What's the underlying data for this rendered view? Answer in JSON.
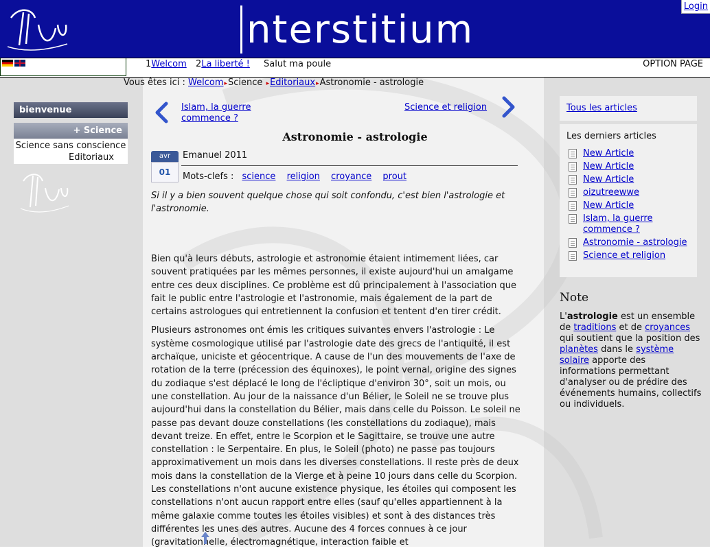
{
  "header": {
    "title": "nterstitium",
    "login": "Login"
  },
  "nav": {
    "items": [
      {
        "num": "1",
        "label": "Welcom"
      },
      {
        "num": "2",
        "label": "La liberté !"
      }
    ],
    "greeting": "Salut ma poule",
    "option": "OPTION PAGE"
  },
  "breadcrumb": {
    "prefix": "Vous êtes ici :",
    "home": "Welcom",
    "section": "Science",
    "sub": "Editoriaux",
    "current": "Astronomie - astrologie"
  },
  "sidebar": {
    "menu1": "bienvenue",
    "menu2": "+ Science",
    "sub1": "Science sans conscience",
    "sub2": "Editoriaux"
  },
  "article": {
    "prev": "Islam, la guerre commence ?",
    "next": "Science et religion",
    "title": "Astronomie - astrologie",
    "date_month": "avr",
    "date_day": "01",
    "author": "Emanuel 2011",
    "tags_label": "Mots-clefs :",
    "tags": [
      "science",
      "religion",
      "croyance",
      "prout"
    ],
    "intro": "Si il y a bien souvent quelque chose qui soit confondu, c'est bien l'astrologie et l'astronomie.",
    "p1": "Bien qu'à leurs débuts, astrologie et astronomie étaient intimement liées, car souvent pratiquées par les mêmes personnes, il existe aujourd'hui un amalgame entre ces deux disciplines. Ce problème est dû principalement à l'association que fait le public entre l'astrologie et l'astronomie, mais également de la part de certains astrologues qui entretiennent la confusion et tentent d'en tirer crédit.",
    "p2": "Plusieurs astronomes ont émis les critiques suivantes envers l'astrologie : Le système cosmologique utilisé par l'astrologie date des grecs de l'antiquité, il est archaïque, uniciste et géocentrique. A cause de l'un des mouvements de l'axe de rotation de la terre (précession des équinoxes), le point vernal, origine des signes du zodiaque s'est déplacé le long de l'écliptique d'environ 30°, soit un mois, ou une constellation. Au jour de la naissance d'un Bélier, le Soleil ne se trouve plus aujourd'hui dans la constellation du Bélier, mais dans celle du Poisson. Le soleil ne passe pas devant douze constellations (les constellations du zodiaque), mais devant treize. En effet, entre le Scorpion et le Sagittaire, se trouve une autre constellation : le Serpentaire. En plus, le Soleil (photo) ne passe pas toujours approximativement un mois dans les diverses constellations. Il reste près de deux mois dans la constellation de la Vierge et à peine 10 jours dans celle du Scorpion. Les constellations n'ont aucune existence physique, les étoiles qui composent les constellations n'ont aucun rapport entre elles (sauf qu'elles appartiennent à la même galaxie comme toutes les étoiles visibles) et sont à des distances très différentes les unes des autres. Aucune des 4 forces connues à ce jour (gravitationnelle, électromagnétique, interaction faible et"
  },
  "right": {
    "all_articles": "Tous les articles",
    "latest_title": "Les derniers articles",
    "latest": [
      "New Article",
      "New Article",
      "New Article",
      "oizutreewwe",
      "New Article",
      "Islam, la guerre commence ?",
      "Astronomie - astrologie",
      "Science et religion"
    ],
    "note_title": "Note",
    "note": {
      "a": "L'",
      "b": "astrologie",
      "c": " est un ensemble de ",
      "d": "traditions",
      "e": " et de ",
      "f": "croyances",
      "g": " qui soutient que la position des ",
      "h": "planètes",
      "i": " dans le ",
      "j": "système solaire",
      "k": " apporte des informations permettant d'analyser ou de prédire des événements humains, collectifs ou individuels."
    }
  },
  "colors": {
    "header_bg": "#0a0e9a",
    "link": "#0000cc",
    "sidebar_bg": "#dedede"
  }
}
